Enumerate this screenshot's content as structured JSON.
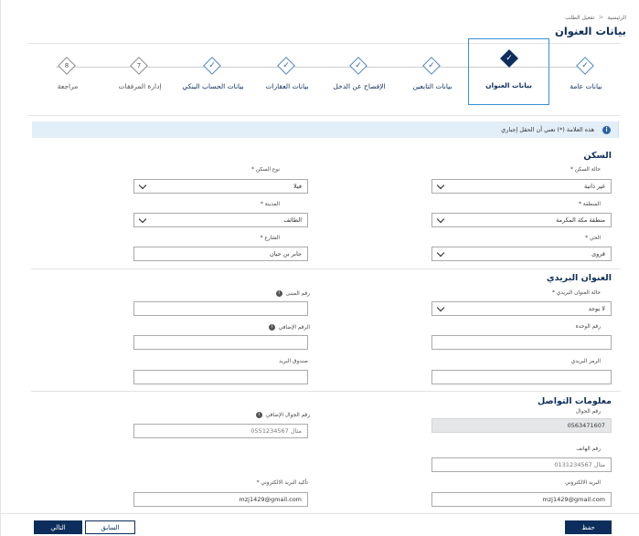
{
  "breadcrumb": {
    "home": "الرئيسية",
    "separator": "<",
    "current": "تفعيل الطلب"
  },
  "page_title": "بيانات العنوان",
  "steps": [
    {
      "number": "",
      "label": "بيانات عامة",
      "state": "done"
    },
    {
      "number": "",
      "label": "بيانات العنوان",
      "state": "active"
    },
    {
      "number": "",
      "label": "بيانات التابعين",
      "state": "done"
    },
    {
      "number": "",
      "label": "الإفصاح عن الدخل",
      "state": "done"
    },
    {
      "number": "",
      "label": "بيانات العقارات",
      "state": "done"
    },
    {
      "number": "",
      "label": "بيانات الحساب البنكي",
      "state": "done"
    },
    {
      "number": "7",
      "label": "إدارة المرفقات",
      "state": "pending"
    },
    {
      "number": "8",
      "label": "مراجعة",
      "state": "pending"
    }
  ],
  "notice": {
    "icon": "info-icon",
    "text": "هذه العلامة (*) تعني أن الحقل إجباري"
  },
  "housing": {
    "title": "السكن",
    "status_label": "حالة السكن *",
    "status_value": "غير ذاتية",
    "type_label": "نوع السكن *",
    "type_value": "فيلا",
    "region_label": "المنطقة *",
    "region_value": "منطقة مكة المكرمة",
    "city_label": "المدينة *",
    "city_value": "الطائف",
    "district_label": "الحي *",
    "district_value": "قروى",
    "street_label": "الشارع *",
    "street_value": "جابر بن حيان"
  },
  "postal": {
    "title": "العنوان البريدي",
    "status_label": "حالة العنوان البريدي *",
    "status_value": "لا يوجد",
    "building_label": "رقم المبنى",
    "unit_label": "رقم الوحدة",
    "additional_label": "الرقم الإضافي",
    "zip_label": "الرمز البريدي",
    "pobox_label": "صندوق البريد"
  },
  "contact": {
    "title": "معلومات التواصل",
    "mobile_label": "رقم الجوال",
    "mobile_value": "0563471607",
    "extra_mobile_label": "رقم الجوال الإضافي",
    "extra_mobile_placeholder": "مثال 0551234567",
    "phone_label": "رقم الهاتف",
    "phone_placeholder": "مثال 0131234567",
    "email_label": "البريد الالكتروني",
    "email_value": "mzj1429@gmail.com",
    "email_confirm_label": "تأكيد البريد الالكتروني *",
    "email_confirm_value": "mzj1429@gmail.com"
  },
  "buttons": {
    "save": "حفظ",
    "previous": "السابق",
    "next": "التالي"
  },
  "colors": {
    "primary": "#0d2e5c",
    "accent": "#3a8fd6",
    "notice_bg": "#e2eef8"
  }
}
